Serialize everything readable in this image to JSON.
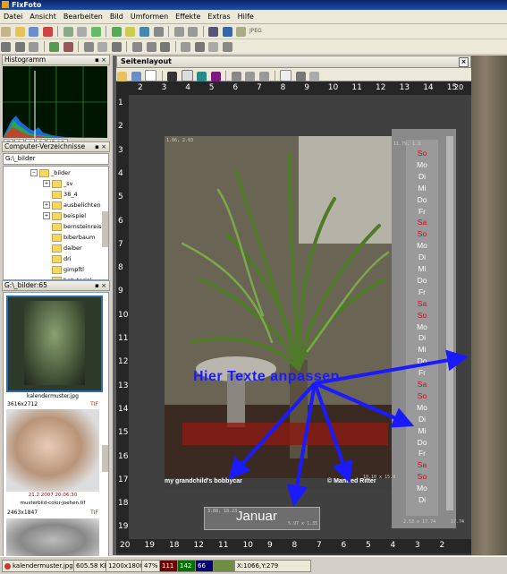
{
  "window": {
    "title": "FixFoto"
  },
  "menu": [
    "Datei",
    "Ansicht",
    "Bearbeiten",
    "Bild",
    "Umformen",
    "Effekte",
    "Extras",
    "Hilfe"
  ],
  "toolbar": {
    "jpeg_label": "JPEG"
  },
  "panels": {
    "histogram": {
      "title": "Histogramm",
      "buttons": [
        "T",
        "R",
        "G",
        "B",
        "IRGB"
      ]
    },
    "directories": {
      "title": "Computer-Verzeichnisse",
      "path": "G:\\_bilder",
      "tree": [
        "_bilder",
        "_sv",
        "38_4",
        "ausbelichten",
        "beispiel",
        "bernsteinreise",
        "biberbaum",
        "daiber",
        "dri",
        "gimpftl",
        "hgtutorial"
      ]
    },
    "thumbnails": {
      "title": "G:\\_bilder:65",
      "items": [
        {
          "caption": "kalendermuster.jpg",
          "info": "3616x2712",
          "type": "TIF"
        },
        {
          "caption": "musterbild-color-joehen.tif",
          "info": "21.2.2007 20:06:30",
          "dims": "2463x1847",
          "type": "TIF"
        }
      ]
    }
  },
  "document": {
    "title": "Seitenlayout",
    "ruler_top": [
      "2",
      "3",
      "4",
      "5",
      "6",
      "7",
      "8",
      "9",
      "10",
      "11",
      "12",
      "13",
      "14",
      "15"
    ],
    "ruler_left": [
      "1",
      "2",
      "3",
      "4",
      "5",
      "6",
      "7",
      "8",
      "9",
      "10",
      "11",
      "12",
      "13",
      "14",
      "15",
      "16",
      "17",
      "18",
      "19"
    ],
    "ruler_bottom": [
      "20",
      "19",
      "18",
      "12",
      "11",
      "10",
      "9",
      "8",
      "7",
      "6",
      "5",
      "4",
      "3",
      "2"
    ],
    "ruler_right": [
      "20",
      "19"
    ],
    "photo_coords": "1.86, 2.03",
    "cal_coords": "11.79, 1.3",
    "cal_size": "2.53 x 17.74",
    "cal_size_right": "17.74",
    "photo_size": "10.10 x 15.0",
    "band_left": "my grandchild's bobbycar",
    "band_right": "© Manfred Ritter",
    "month": "Januar",
    "month_coords": "3.88, 18.23",
    "month_size": "5.97 x 1.35",
    "annotation": "Hier Texte anpassen",
    "days": [
      "So",
      "Mo",
      "Di",
      "Mi",
      "Do",
      "Fr",
      "Sa",
      "So",
      "Mo",
      "Di",
      "Mi",
      "Do",
      "Fr",
      "Sa",
      "So",
      "Mo",
      "Di",
      "Mi",
      "Do",
      "Fr",
      "Sa",
      "So",
      "Mo",
      "Di",
      "Mi",
      "Do",
      "Fr",
      "Sa",
      "So",
      "Mo",
      "Di"
    ],
    "red_days": [
      0,
      6,
      7,
      13,
      14,
      20,
      21,
      27,
      28
    ]
  },
  "status": {
    "filename": "kalendermuster.jpg",
    "filesize": "605.58 KB",
    "dimensions": "1200x1800",
    "zoom": "47%",
    "r": "111",
    "g": "142",
    "b": "66",
    "coords": "X:1066,Y:279"
  },
  "colors": {
    "accent": "#1a1aff",
    "red_day": "#e0001a",
    "titlebar": "#0a246a"
  }
}
